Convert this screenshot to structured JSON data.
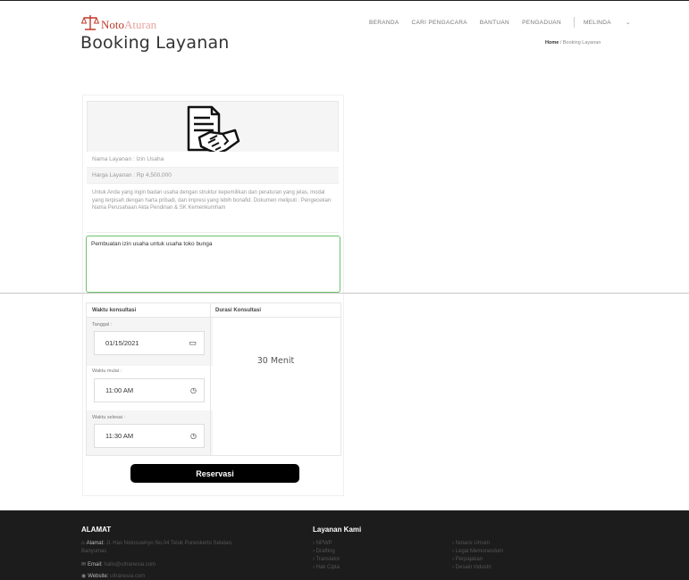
{
  "brand": {
    "name_part1": "Noto",
    "name_part2": "Aturan"
  },
  "page_title": "Booking Layanan",
  "nav": [
    "BERANDA",
    "CARI PENGACARA",
    "BANTUAN",
    "PENGADUAN"
  ],
  "user_menu": "MELINDA",
  "breadcrumb": {
    "home": "Home",
    "separator": "/",
    "current": "Booking Layanan"
  },
  "service": {
    "name": "Nama Layanan : Izin Usaha",
    "price": "Harga Layanan : Rp 4,500,000",
    "description": "Untuk Anda yang ingin badan usaha dengan struktur kepemilikan dan peraturan yang jelas, modal yang terpisah dengan harta pribadi, dan impresi yang lebih bonafid. Dokumen meliputi : Pengecekan Nama Perusahaan Akta Pendirian & SK Kemenkumham"
  },
  "notes_value": "Pembuatan izin usaha untuk usaha toko bunga",
  "schedule": {
    "col_time": "Waktu konsultasi",
    "col_duration": "Durasi Konsultasi",
    "date_label": "Tanggal :",
    "date_value": "01/15/2021",
    "start_label": "Waktu mulai :",
    "start_value": "11:00 AM",
    "end_label": "Waktu selesai :",
    "end_value": "11:30 AM",
    "duration_value": "30 Menit"
  },
  "reserve_button": "Reservasi",
  "footer": {
    "address_heading": "ALAMAT",
    "address_label": "Alamat:",
    "address_value": "Jl. Has Notosuwiryo No.04 Teluk Purwokerto Selatan, Banyumas",
    "email_label": "Email:",
    "email_value": "hallo@ultranesia.com",
    "website_label": "Website:",
    "website_value": "ultranesia.com",
    "services_heading": "Layanan Kami",
    "services_col1": [
      "› NPWP",
      "› Drafting",
      "› Translator",
      "› Hak Cipta"
    ],
    "services_col2": [
      "› Notaris Umum",
      "› Legal Memorandum",
      "› Perpajakan",
      "› Desain Industri"
    ]
  }
}
